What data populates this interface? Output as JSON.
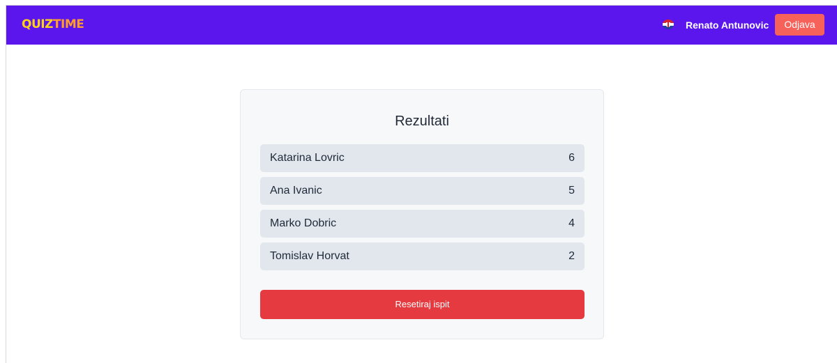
{
  "header": {
    "logo_part1": "QUIZ",
    "logo_part2": "TIME",
    "user_name": "Renato Antunovic",
    "logout_label": "Odjava",
    "flag_icon": "croatia-flag-icon",
    "colors": {
      "navbar": "#5b16ee",
      "logout": "#f6615a",
      "logo_yellow": "#ffd31a",
      "logo_orange": "#ff9d2e"
    }
  },
  "results_card": {
    "title": "Rezultati",
    "rows": [
      {
        "name": "Katarina Lovric",
        "score": "6"
      },
      {
        "name": "Ana Ivanic",
        "score": "5"
      },
      {
        "name": "Marko Dobric",
        "score": "4"
      },
      {
        "name": "Tomislav Horvat",
        "score": "2"
      }
    ],
    "reset_label": "Resetiraj ispit",
    "colors": {
      "reset": "#e53a3f",
      "row_bg": "#e2e7ee"
    }
  }
}
